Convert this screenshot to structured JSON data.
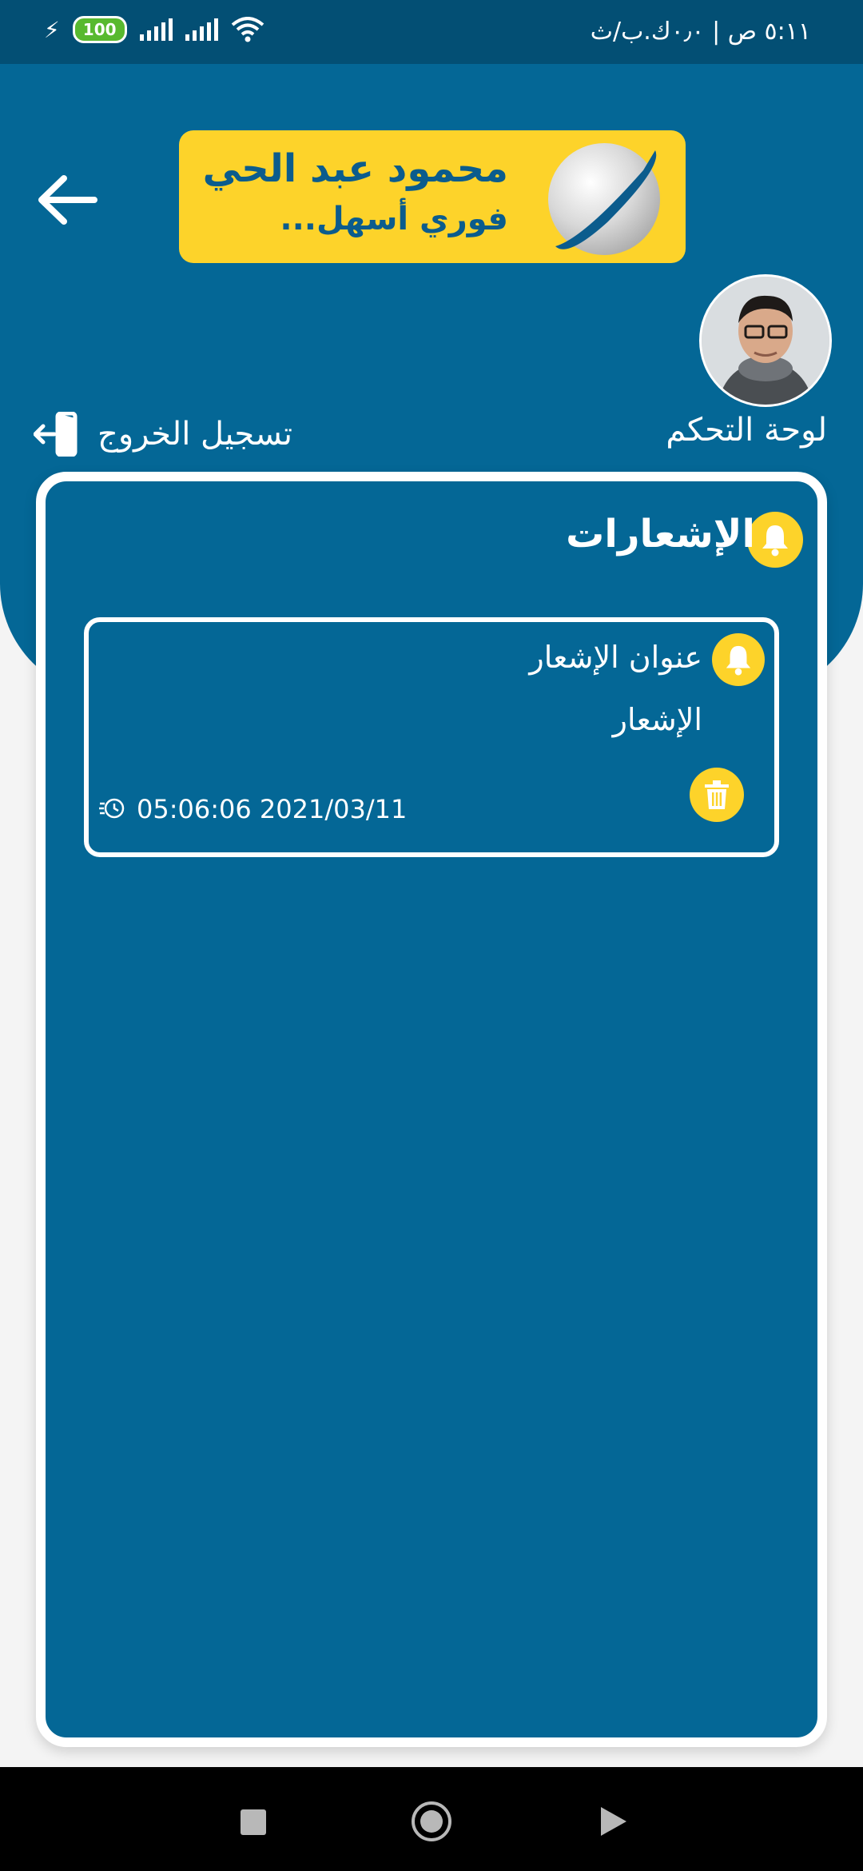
{
  "status_bar": {
    "time": "٥:١١ ص | ٠٫٠ك.ب/ث",
    "battery": "100"
  },
  "logo": {
    "line1": "محمود عبد الحي",
    "line2": "فوري أسهل..."
  },
  "nav": {
    "dashboard_label": "لوحة التحكم",
    "logout_label": "تسجيل الخروج"
  },
  "notifications": {
    "title": "الإشعارات",
    "items": [
      {
        "title": "عنوان الإشعار",
        "body": "الإشعار",
        "timestamp": "05:06:06 2021/03/11"
      }
    ]
  },
  "colors": {
    "primary": "#046796",
    "accent": "#fdd32a",
    "status_bar": "#034f74"
  },
  "icons": [
    "back-arrow-icon",
    "bell-icon",
    "logout-icon",
    "trash-icon",
    "clock-icon",
    "wifi-icon",
    "signal-icon",
    "battery-icon"
  ]
}
